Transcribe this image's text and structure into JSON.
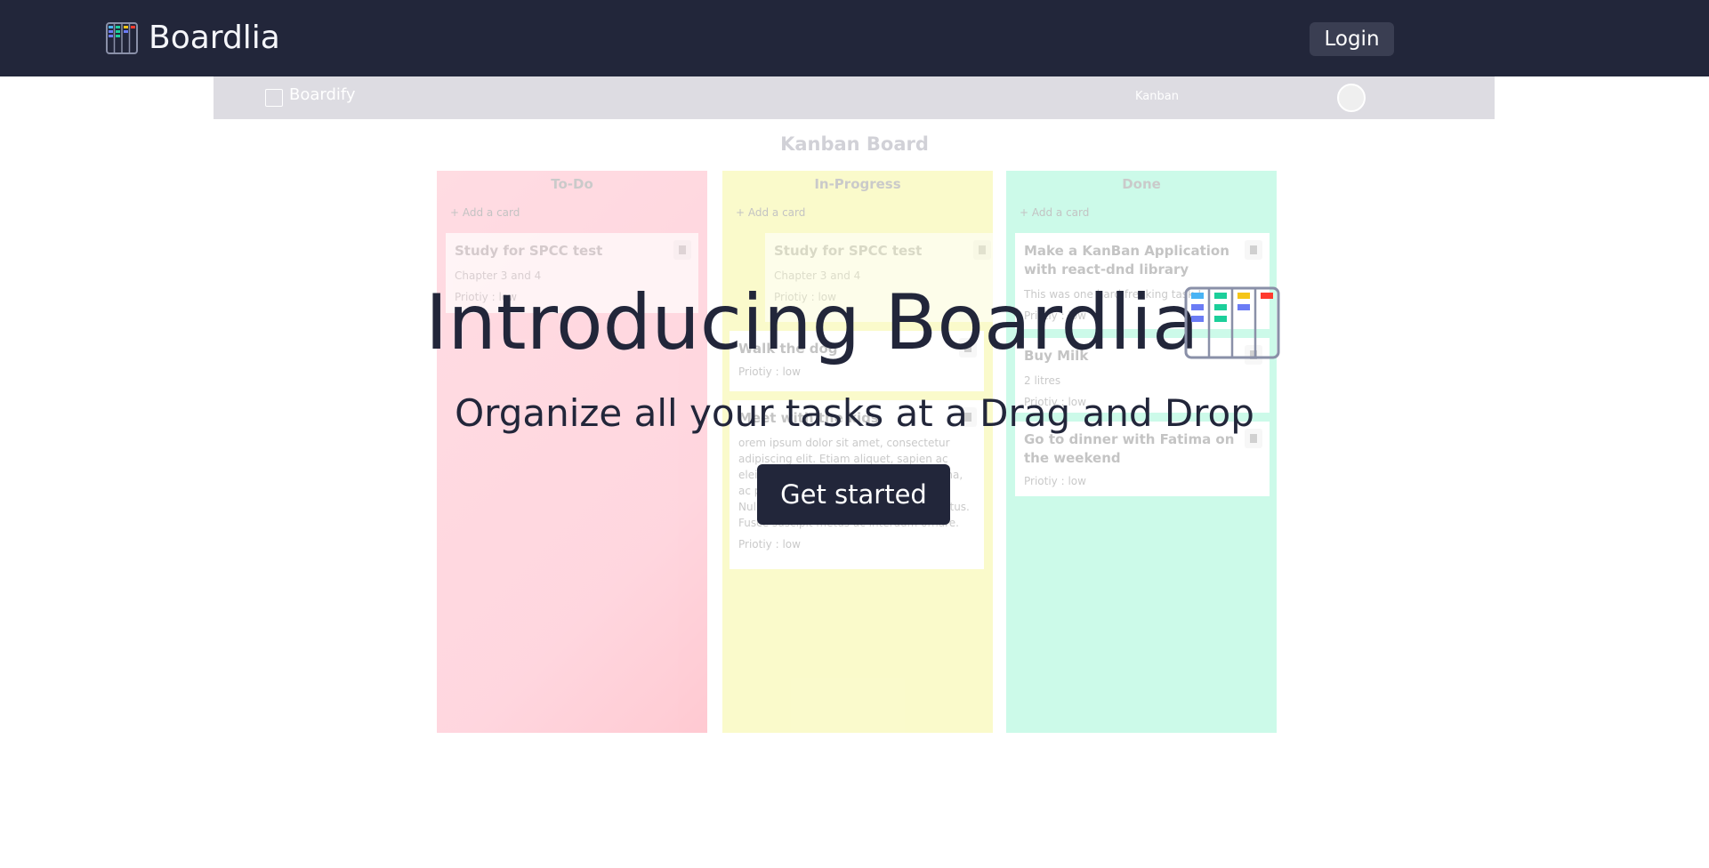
{
  "nav": {
    "brand": "Boardlia",
    "login_label": "Login"
  },
  "preview": {
    "brand": "Boardify",
    "nav_link": "Kanban",
    "title": "Kanban Board",
    "add_card": "+ Add a card",
    "columns": [
      {
        "name": "To-Do",
        "color": "#ffb2c0",
        "cards": [
          {
            "title": "Study for SPCC test",
            "desc": "Chapter 3 and 4",
            "priority": "Priotiy : low"
          }
        ]
      },
      {
        "name": "In-Progress",
        "color": "#f5f58e",
        "cards": [
          {
            "title": "Study for SPCC test",
            "desc": "Chapter 3 and 4",
            "priority": "Priotiy : low"
          },
          {
            "title": "Walk the dog",
            "priority": "Priotiy : low"
          },
          {
            "title": "Meet with the kids",
            "desc": "orem ipsum dolor sit amet, consectetur adipiscing elit. Etiam aliquet, sapien ac eleifend consequat, lacus erat porta urna, ac pellentesque elit lorem posuere elit. Nullam dictum efficitur, consectetur lectus. Fusce suscipit metus ac interdum ornare.",
            "priority": "Priotiy : low"
          }
        ]
      },
      {
        "name": "Done",
        "color": "#8ff5cf",
        "cards": [
          {
            "title": "Make a KanBan Application with react-dnd library",
            "desc": "This was one hard freaking task !",
            "priority": "Priotiy : low"
          },
          {
            "title": "Buy Milk",
            "desc": "2 litres",
            "priority": "Priotiy : low"
          },
          {
            "title": "Go to dinner with Fatima on the weekend",
            "priority": "Priotiy : low"
          }
        ]
      }
    ]
  },
  "hero": {
    "title": "Introducing Boardlia",
    "subtitle": "Organize all your tasks at a Drag and Drop",
    "cta_label": "Get started"
  },
  "colors": {
    "navy": "#22263a",
    "accent_blue": "#4ab3f4",
    "accent_green": "#1ccf9a",
    "accent_yellow": "#f5c518",
    "accent_red": "#ff3b2f",
    "accent_purple": "#6b7cf5"
  },
  "icons": {
    "logo": "kanban-board-icon"
  }
}
